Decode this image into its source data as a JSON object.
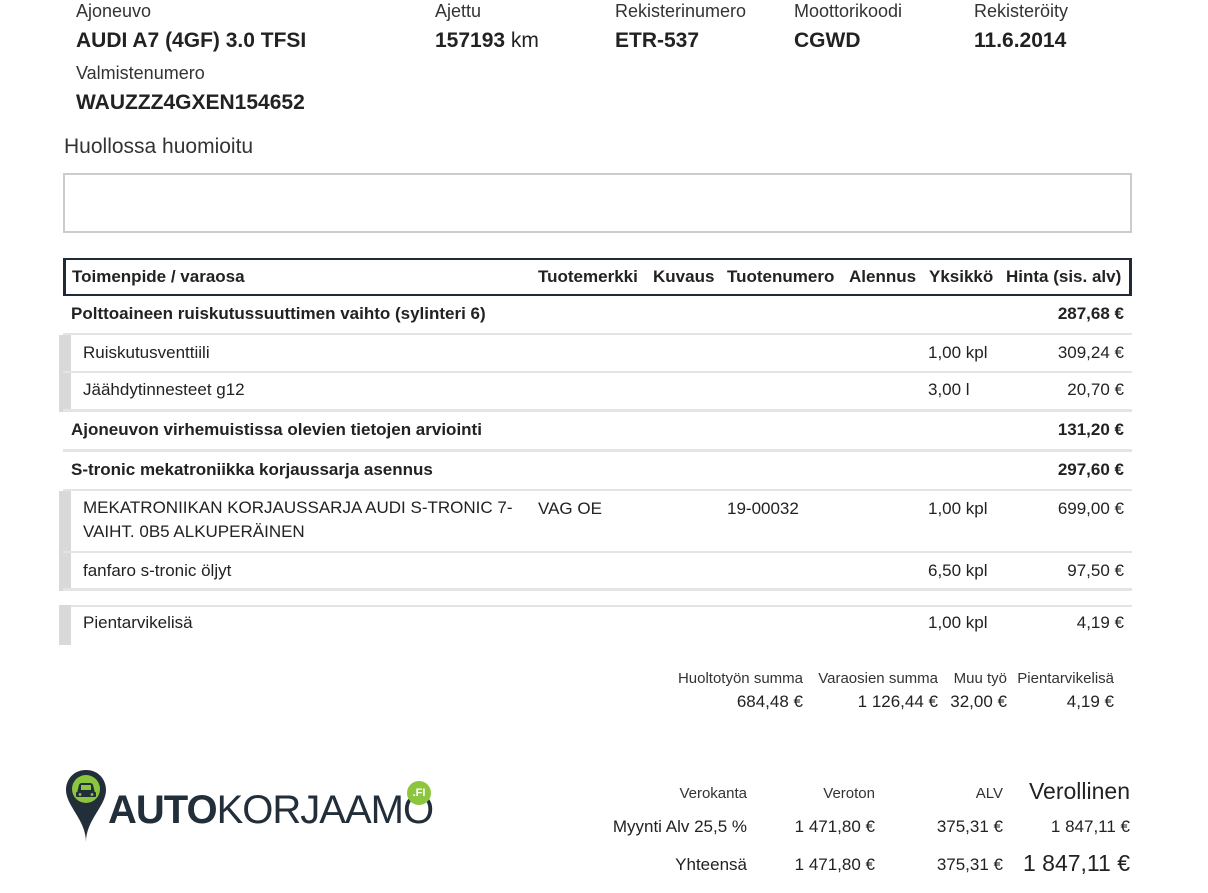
{
  "vehicle": {
    "model_label": "Ajoneuvo",
    "model": "AUDI A7 (4GF) 3.0 TFSI",
    "mileage_label": "Ajettu",
    "mileage": "157193",
    "mileage_unit": " km",
    "plate_label": "Rekisterinumero",
    "plate": "ETR-537",
    "engine_label": "Moottorikoodi",
    "engine": "CGWD",
    "registered_label": "Rekisteröity",
    "registered": "11.6.2014",
    "vin_label": "Valmistenumero",
    "vin": "WAUZZZ4GXEN154652"
  },
  "notes": {
    "title": "Huollossa huomioitu",
    "content": ""
  },
  "table": {
    "headers": [
      "Toimenpide / varaosa",
      "Tuotemerkki",
      "Kuvaus",
      "Tuotenumero",
      "Alennus",
      "Yksikkö",
      "Hinta (sis. alv)"
    ],
    "rows": [
      {
        "name": "Polttoaineen ruiskutussuuttimen vaihto (sylinteri 6)",
        "brand": "",
        "code": "",
        "unit": "",
        "price": "287,68 €"
      },
      {
        "name": "Ruiskutusventtiili",
        "brand": "",
        "code": "",
        "unit": "1,00 kpl",
        "price": "309,24 €"
      },
      {
        "name": "Jäähdytinnesteet g12",
        "brand": "",
        "code": "",
        "unit": "3,00 l",
        "price": "20,70 €"
      },
      {
        "name": "Ajoneuvon virhemuistissa olevien tietojen arviointi",
        "brand": "",
        "code": "",
        "unit": "",
        "price": "131,20 €"
      },
      {
        "name": "S-tronic mekatroniikka korjaussarja asennus",
        "brand": "",
        "code": "",
        "unit": "",
        "price": "297,60 €"
      },
      {
        "name": "MEKATRONIIKAN KORJAUSSARJA AUDI S-TRONIC 7-VAIHT. 0B5 ALKUPERÄINEN",
        "brand": "VAG OE",
        "code": "19-00032",
        "unit": "1,00 kpl",
        "price": "699,00 €"
      },
      {
        "name": "fanfaro s-tronic öljyt",
        "brand": "",
        "code": "",
        "unit": "6,50 kpl",
        "price": "97,50 €"
      },
      {
        "name": "Pientarvikelisä",
        "brand": "",
        "code": "",
        "unit": "1,00 kpl",
        "price": "4,19 €"
      }
    ]
  },
  "summary": {
    "labor_label": "Huoltotyön summa",
    "labor": "684,48 €",
    "parts_label": "Varaosien summa",
    "parts": "1 126,44 €",
    "other_label": "Muu työ",
    "other": "32,00 €",
    "supplies_label": "Pientarvikelisä",
    "supplies": "4,19 €"
  },
  "logo": {
    "auto": "AUTO",
    "korjaamo": "KORJAAMO",
    "fi": ".FI"
  },
  "tax": {
    "h_rate": "Verokanta",
    "h_net": "Veroton",
    "h_vat": "ALV",
    "h_gross": "Verollinen",
    "row_label": "Myynti Alv 25,5 %",
    "row_net": "1 471,80 €",
    "row_vat": "375,31 €",
    "row_gross": "1 847,11 €",
    "total_label": "Yhteensä",
    "total_net": "1 471,80 €",
    "total_vat": "375,31 €",
    "total_gross": "1 847,11 €"
  },
  "colors": {
    "header_border": "#1f2a36",
    "logo_navy": "#222f3b",
    "logo_green": "#8cc63f"
  }
}
